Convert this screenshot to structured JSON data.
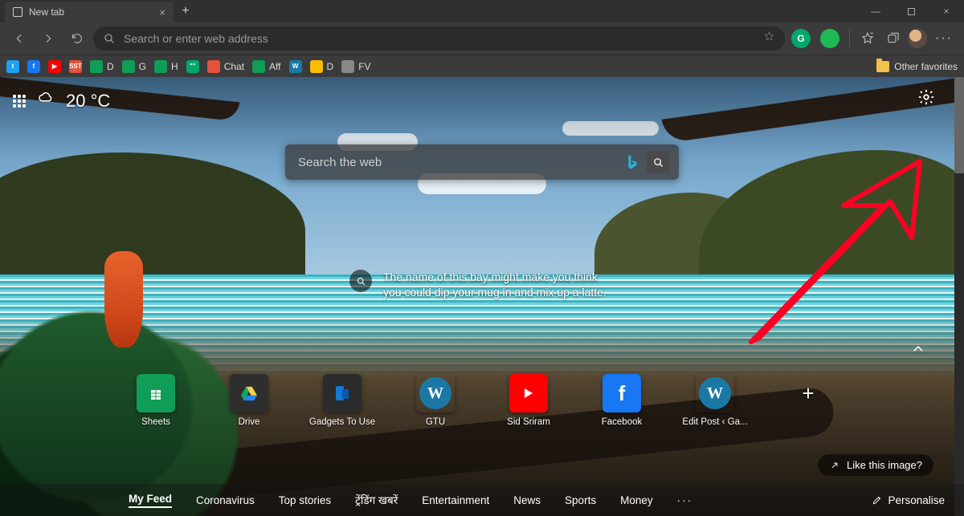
{
  "titlebar": {
    "tab_title": "New tab"
  },
  "toolbar": {
    "address_placeholder": "Search or enter web address",
    "extension_initial": "G"
  },
  "bookmarks": {
    "items": [
      {
        "label": "",
        "color": "#1da1f2",
        "glyph": "t"
      },
      {
        "label": "",
        "color": "#1877f2",
        "glyph": "f"
      },
      {
        "label": "",
        "color": "#ff0000",
        "glyph": "▶"
      },
      {
        "label": "",
        "color": "#e2523c",
        "glyph": "SST"
      },
      {
        "label": "D",
        "color": "#0f9d58",
        "glyph": ""
      },
      {
        "label": "G",
        "color": "#0f9d58",
        "glyph": ""
      },
      {
        "label": "H",
        "color": "#0f9d58",
        "glyph": ""
      },
      {
        "label": "",
        "color": "#00a86b",
        "glyph": "\"\""
      },
      {
        "label": "Chat",
        "color": "#e2523c",
        "glyph": ""
      },
      {
        "label": "Aff",
        "color": "#0f9d58",
        "glyph": ""
      },
      {
        "label": "",
        "color": "#1b78a5",
        "glyph": "W"
      },
      {
        "label": "D",
        "color": "#fbbc05",
        "glyph": ""
      },
      {
        "label": "FV",
        "color": "#888",
        "glyph": ""
      },
      {
        "label": "",
        "color": "#3b3b3b",
        "glyph": ""
      }
    ],
    "other_label": "Other favorites"
  },
  "ntp": {
    "temperature": "20 °C",
    "search_placeholder": "Search the web",
    "caption": "The name of this bay might make you think you could dip your mug in and mix up a latte.",
    "like_label": "Like this image?",
    "tiles": [
      {
        "label": "Sheets",
        "kind": "sheets"
      },
      {
        "label": "Drive",
        "kind": "drive"
      },
      {
        "label": "Gadgets To Use",
        "kind": "gtu"
      },
      {
        "label": "GTU",
        "kind": "wp"
      },
      {
        "label": "Sid Sriram",
        "kind": "yt"
      },
      {
        "label": "Facebook",
        "kind": "fb"
      },
      {
        "label": "Edit Post ‹ Ga...",
        "kind": "wp"
      }
    ]
  },
  "feed": {
    "items": [
      "My Feed",
      "Coronavirus",
      "Top stories",
      "ट्रेंडिंग खबरें",
      "Entertainment",
      "News",
      "Sports",
      "Money"
    ],
    "personalise": "Personalise"
  }
}
